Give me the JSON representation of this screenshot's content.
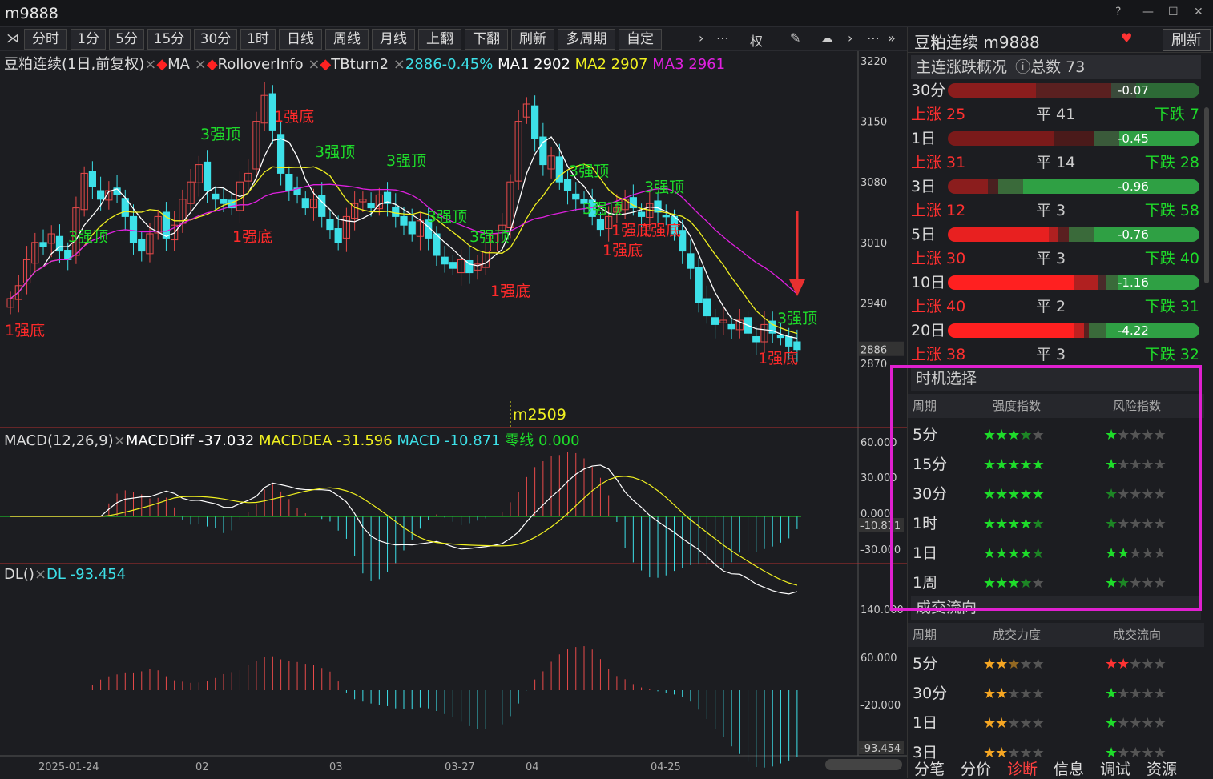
{
  "window": {
    "title": "m9888"
  },
  "toolbar": {
    "buttons": [
      "分时",
      "1分",
      "5分",
      "15分",
      "30分",
      "1时",
      "日线",
      "周线",
      "月线",
      "上翻",
      "下翻",
      "刷新",
      "多周期",
      "自定"
    ]
  },
  "legend": {
    "main_name": "豆粕连续(1日,前复权)",
    "ma": "MA",
    "rollover": "RolloverInfo",
    "tbturn": "TBturn2",
    "price_change": "2886-0.45%",
    "ma1": "MA1 2902",
    "ma2": "MA2 2907",
    "ma3": "MA3 2961"
  },
  "macd_legend": {
    "name": "MACD(12,26,9)",
    "diff": "MACDDiff -37.032",
    "dea": "MACDDEA -31.596",
    "macd": "MACD -10.871",
    "zero": "零线 0.000"
  },
  "dl_legend": {
    "name": "DL()",
    "dl": "DL -93.454"
  },
  "contract_label": "m2509",
  "price_axis": [
    "3220",
    "3150",
    "3080",
    "3010",
    "2940",
    "2886",
    "2870"
  ],
  "macd_axis": [
    "60.000",
    "30.000",
    "0.000",
    "-10.871",
    "-30.000"
  ],
  "dl_axis": [
    "140.000",
    "60.000",
    "-20.000",
    "-93.454"
  ],
  "date_axis": [
    "2025-01-24",
    "02",
    "03",
    "03-27",
    "04",
    "04-25"
  ],
  "signals": [
    {
      "text": "1强底",
      "color": "red"
    },
    {
      "text": "3强顶",
      "color": "green"
    },
    {
      "text": "1强底",
      "color": "red"
    },
    {
      "text": "3强顶",
      "color": "green"
    },
    {
      "text": "1强底",
      "color": "red"
    },
    {
      "text": "3强顶",
      "color": "green"
    },
    {
      "text": "3强顶",
      "color": "green"
    },
    {
      "text": "3强顶",
      "color": "green"
    },
    {
      "text": "3强顶",
      "color": "green"
    },
    {
      "text": "1强底",
      "color": "red"
    },
    {
      "text": "3强顶",
      "color": "green"
    },
    {
      "text": "3强顶",
      "color": "green"
    },
    {
      "text": "1强底",
      "color": "red"
    },
    {
      "text": "1强底",
      "color": "red"
    },
    {
      "text": "1强底",
      "color": "red"
    },
    {
      "text": "3强顶",
      "color": "green"
    },
    {
      "text": "3强顶",
      "color": "green"
    },
    {
      "text": "1强底",
      "color": "red"
    }
  ],
  "right": {
    "title": "豆粕连续 m9888",
    "refresh": "刷新",
    "overview": {
      "title": "主连涨跌概况",
      "total": "总数 73",
      "rows": [
        {
          "period": "30分",
          "value": "-0.07",
          "up": "上涨 25",
          "flat": "平 41",
          "down": "下跌 7"
        },
        {
          "period": "1日",
          "value": "-0.45",
          "up": "上涨 31",
          "flat": "平 14",
          "down": "下跌 28"
        },
        {
          "period": "3日",
          "value": "-0.96",
          "up": "上涨 12",
          "flat": "平 3",
          "down": "下跌 58"
        },
        {
          "period": "5日",
          "value": "-0.76",
          "up": "上涨 30",
          "flat": "平 3",
          "down": "下跌 40"
        },
        {
          "period": "10日",
          "value": "-1.16",
          "up": "上涨 40",
          "flat": "平 2",
          "down": "下跌 31"
        },
        {
          "period": "20日",
          "value": "-4.22",
          "up": "上涨 38",
          "flat": "平 3",
          "down": "下跌 32"
        }
      ]
    },
    "timing": {
      "title": "时机选择",
      "col1": "周期",
      "col2": "强度指数",
      "col3": "风险指数",
      "rows": [
        {
          "period": "5分",
          "strength": 3.5,
          "risk": 1
        },
        {
          "period": "15分",
          "strength": 5,
          "risk": 1
        },
        {
          "period": "30分",
          "strength": 5,
          "risk": 0.5
        },
        {
          "period": "1时",
          "strength": 4.5,
          "risk": 0.5
        },
        {
          "period": "1日",
          "strength": 4.5,
          "risk": 2
        },
        {
          "period": "1周",
          "strength": 3.5,
          "risk": 1.5
        }
      ]
    },
    "flow": {
      "title": "成交流向",
      "col1": "周期",
      "col2": "成交力度",
      "col3": "成交流向",
      "rows": [
        {
          "period": "5分",
          "strength": 2.5,
          "flow": 2
        },
        {
          "period": "30分",
          "strength": 2,
          "flow": 1
        },
        {
          "period": "1日",
          "strength": 2,
          "flow": 1
        },
        {
          "period": "3日",
          "strength": 2,
          "flow": 1
        }
      ]
    },
    "tabs": [
      "分笔",
      "分价",
      "诊断",
      "信息",
      "调试",
      "资源"
    ]
  }
}
